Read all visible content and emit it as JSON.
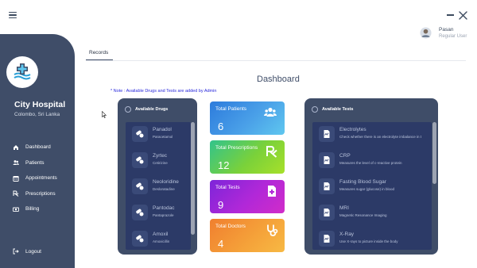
{
  "window": {
    "menu_icon": "hamburger-icon",
    "minimize_icon": "minimize-icon",
    "close_icon": "close-icon"
  },
  "sidebar": {
    "logo_icon": "hospital-logo",
    "hospital_name": "City Hospital",
    "location": "Colombo, Sri Lanka",
    "items": [
      {
        "label": "Dashboard",
        "icon": "home-icon"
      },
      {
        "label": "Patients",
        "icon": "users-icon"
      },
      {
        "label": "Appointments",
        "icon": "calendar-icon"
      },
      {
        "label": "Prescriptions",
        "icon": "rx-icon"
      },
      {
        "label": "Billing",
        "icon": "money-icon"
      }
    ],
    "logout_label": "Logout",
    "logout_icon": "logout-icon"
  },
  "user": {
    "name": "Pasan",
    "role": "Regular User",
    "avatar_icon": "user-avatar-icon"
  },
  "tabs": [
    {
      "label": "Records",
      "active": true
    }
  ],
  "dashboard": {
    "title": "Dashboard",
    "note": "* Note : Available Drugs and Tests are added by Admin"
  },
  "drugs_panel": {
    "title": "Available Drugs",
    "items": [
      {
        "name": "Panadol",
        "generic": "Paracetamol"
      },
      {
        "name": "Zyrtec",
        "generic": "Cetirizine"
      },
      {
        "name": "Neoloridine",
        "generic": "Desloratadine"
      },
      {
        "name": "Pantodac",
        "generic": "Pantaprazole"
      },
      {
        "name": "Amoxil",
        "generic": "Amoxicillin"
      }
    ]
  },
  "stats": [
    {
      "label": "Total Patients",
      "value": "6",
      "icon": "patients-group-icon"
    },
    {
      "label": "Total Prescriptions",
      "value": "12",
      "icon": "rx-icon"
    },
    {
      "label": "Total Tests",
      "value": "9",
      "icon": "medical-document-icon"
    },
    {
      "label": "Total Doctors",
      "value": "4",
      "icon": "stethoscope-icon"
    }
  ],
  "tests_panel": {
    "title": "Available Tests",
    "items": [
      {
        "name": "Electrolytes",
        "description": "Check whether there is an electrolyte imbalance in t"
      },
      {
        "name": "CRP",
        "description": "Measures the level of c-reactive protein"
      },
      {
        "name": "Fasting Blood Sugar",
        "description": "Measures sugar (glucose) in blood"
      },
      {
        "name": "MRI",
        "description": "Magnetic Resonance Imaging"
      },
      {
        "name": "X-Ray",
        "description": "Use X-rays to picture inside the body"
      }
    ]
  },
  "colors": {
    "sidebar": "#3f4d68",
    "panel": "#3f4d68",
    "list_bg": "#2c3a67",
    "accent_blue": "#2a2adc"
  }
}
